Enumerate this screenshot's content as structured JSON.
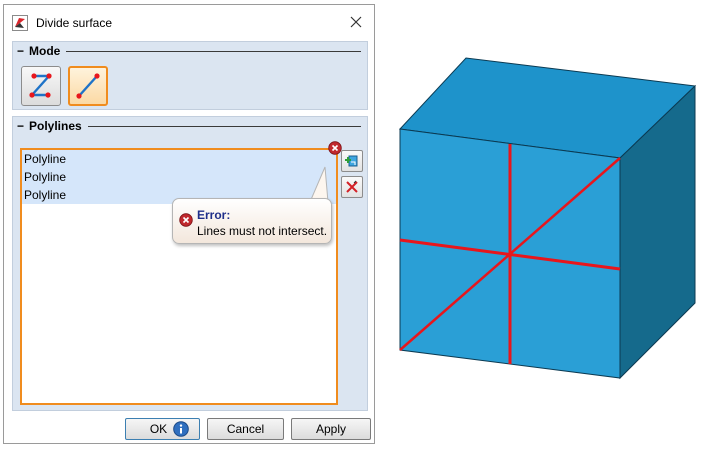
{
  "dialog": {
    "title": "Divide surface",
    "app_icon": "app-icon",
    "close_icon": "close-icon"
  },
  "mode": {
    "header": "Mode",
    "buttons": [
      {
        "icon": "polyline-zigzag-icon",
        "selected": false
      },
      {
        "icon": "straight-line-icon",
        "selected": true
      }
    ]
  },
  "polylines": {
    "header": "Polylines",
    "items": [
      "Polyline",
      "Polyline",
      "Polyline"
    ],
    "side_buttons": [
      "add-polyline-icon",
      "delete-icon"
    ]
  },
  "error": {
    "title": "Error:",
    "message": "Lines must not intersect."
  },
  "footer": {
    "ok": "OK",
    "cancel": "Cancel",
    "apply": "Apply"
  },
  "colors": {
    "accent_orange": "#f08c1e",
    "group_bg": "#dbe5f1",
    "list_selection": "#d5e6fa",
    "cube_front": "#2a9fd6",
    "cube_top": "#1e93cb",
    "cube_side": "#156a8c",
    "division_line": "#e8161c",
    "error_red": "#c0282d",
    "error_title": "#1f2f8a"
  }
}
